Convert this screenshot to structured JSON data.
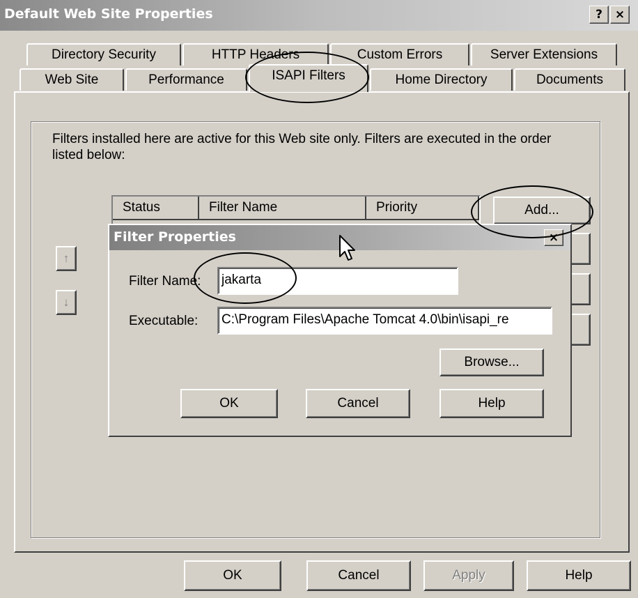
{
  "window": {
    "title": "Default Web Site Properties",
    "help_glyph": "?",
    "close_glyph": "×"
  },
  "tabs_back": [
    "Directory Security",
    "HTTP Headers",
    "Custom Errors",
    "Server Extensions"
  ],
  "tabs_front": [
    "Web Site",
    "Performance",
    "ISAPI Filters",
    "Home Directory",
    "Documents"
  ],
  "active_tab": "ISAPI Filters",
  "filters": {
    "description": "Filters installed here are active for this Web site only. Filters are executed in the order listed below:",
    "columns": [
      "Status",
      "Filter Name",
      "Priority"
    ],
    "add_label": "Add...",
    "move_up_glyph": "↑",
    "move_down_glyph": "↓"
  },
  "dialog": {
    "title": "Filter Properties",
    "close_glyph": "×",
    "filter_name_label": "Filter Name:",
    "filter_name_value": "jakarta",
    "executable_label": "Executable:",
    "executable_value": "C:\\Program Files\\Apache Tomcat 4.0\\bin\\isapi_re",
    "browse_label": "Browse...",
    "ok_label": "OK",
    "cancel_label": "Cancel",
    "help_label": "Help"
  },
  "footer": {
    "ok_label": "OK",
    "cancel_label": "Cancel",
    "apply_label": "Apply",
    "help_label": "Help"
  }
}
